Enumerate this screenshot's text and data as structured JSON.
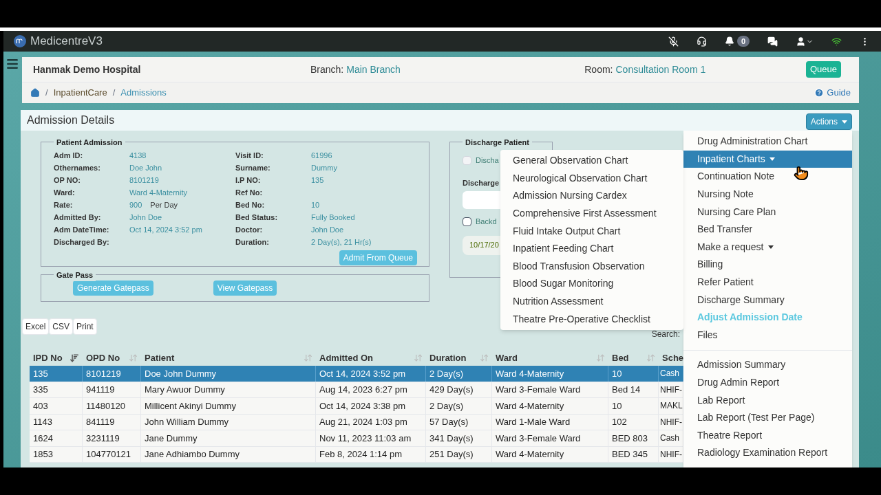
{
  "navbar": {
    "brand": "MedicentreV3",
    "notifications": "0"
  },
  "header": {
    "hospital": "Hanmak Demo Hospital",
    "branch_label": "Branch:",
    "branch": "Main Branch",
    "room_label": "Room:",
    "room": "Consultation Room 1",
    "queue_button": "Queue"
  },
  "breadcrumb": {
    "separator": "/",
    "items": [
      "InpatientCare",
      "Admissions"
    ],
    "guide": "Guide"
  },
  "card": {
    "title": "Admission Details",
    "actions_button": "Actions"
  },
  "patient_admission": {
    "legend": "Patient Admission",
    "left": [
      {
        "label": "Adm ID:",
        "value": "4138"
      },
      {
        "label": "Othernames:",
        "value": "Doe John"
      },
      {
        "label": "OP NO:",
        "value": "8101219"
      },
      {
        "label": "Ward:",
        "value": "Ward 4-Maternity"
      },
      {
        "label": "Rate:",
        "value": "900",
        "suffix": "Per Day"
      },
      {
        "label": "Admitted By:",
        "value": "John Doe"
      },
      {
        "label": "Adm DateTime:",
        "value": "Oct 14, 2024 3:52 pm"
      },
      {
        "label": "Discharged By:"
      }
    ],
    "right": [
      {
        "label": "Visit ID:",
        "value": "61996"
      },
      {
        "label": "Surname:",
        "value": "Dummy"
      },
      {
        "label": "I.P NO:",
        "value": "135"
      },
      {
        "label": "Ref No:"
      },
      {
        "label": "Bed No:",
        "value": "10"
      },
      {
        "label": "Bed Status:",
        "value": "Fully Booked"
      },
      {
        "label": "Doctor:",
        "value": "John Doe"
      },
      {
        "label": "Duration:",
        "value": "2 Day(s), 21 Hr(s)"
      }
    ],
    "button": "Admit From Queue"
  },
  "gate_pass": {
    "legend": "Gate Pass",
    "buttons": [
      "Generate Gatepass",
      "View Gatepass"
    ]
  },
  "discharge": {
    "legend": "Discharge Patient",
    "checkbox": {
      "label": "Discha",
      "checked": false,
      "disabled": true
    },
    "field_label": "Discharge",
    "backdate": {
      "label": "Backd",
      "checked": false,
      "disabled": false
    },
    "date": "10/17/20"
  },
  "export_buttons": [
    "Excel",
    "CSV",
    "Print"
  ],
  "search_label": "Search:",
  "table": {
    "columns": [
      {
        "label": "IPD No",
        "sorted": true
      },
      {
        "label": "OPD No",
        "sorted": false
      },
      {
        "label": "Patient",
        "sorted": false
      },
      {
        "label": "Admitted On",
        "sorted": false
      },
      {
        "label": "Duration",
        "sorted": false
      },
      {
        "label": "Ward",
        "sorted": false
      },
      {
        "label": "Bed",
        "sorted": false
      },
      {
        "label": "Sche"
      }
    ],
    "rows": [
      {
        "selected": true,
        "cells": [
          "135",
          "8101219",
          "Doe John Dummy",
          "Oct 14, 2024 3:52 pm",
          "2 Day(s)",
          "Ward 4-Maternity",
          "10",
          "Cash"
        ]
      },
      {
        "selected": false,
        "cells": [
          "335",
          "941119",
          "Mary Awuor Dummy",
          "Aug 14, 2023 6:27 pm",
          "429 Day(s)",
          "Ward 3-Female Ward",
          "Bed 14",
          "NHIF-"
        ]
      },
      {
        "selected": false,
        "cells": [
          "403",
          "11480120",
          "Millicent Akinyi Dummy",
          "Oct 14, 2024 3:38 pm",
          "2 Day(s)",
          "Ward 4-Maternity",
          "10",
          "MAKL"
        ]
      },
      {
        "selected": false,
        "cells": [
          "1143",
          "841119",
          "John William Dummy",
          "Aug 21, 2024 1:03 pm",
          "57 Day(s)",
          "Ward 1-Male Ward",
          "102",
          "NHIF-"
        ]
      },
      {
        "selected": false,
        "cells": [
          "1624",
          "3231119",
          "Jane Dummy",
          "Nov 11, 2023 11:03 am",
          "341 Day(s)",
          "Ward 3-Female Ward",
          "BED 803",
          "Cash"
        ]
      },
      {
        "selected": false,
        "cells": [
          "1853",
          "104770121",
          "Jane Adhiambo Dummy",
          "Feb 8, 2024 1:14 pm",
          "251 Day(s)",
          "Ward 4-Maternity",
          "BED 345",
          "NHIF-"
        ]
      }
    ]
  },
  "actions_menu": {
    "groups": [
      [
        {
          "label": "Drug Administration Chart",
          "kind": "item",
          "selected": false
        },
        {
          "label": "Inpatient Charts",
          "kind": "dropdown",
          "selected": true
        },
        {
          "label": "Continuation Note",
          "kind": "item",
          "selected": false
        },
        {
          "label": "Nursing Note",
          "kind": "item",
          "selected": false
        },
        {
          "label": "Nursing Care Plan",
          "kind": "item",
          "selected": false
        },
        {
          "label": "Bed Transfer",
          "kind": "item",
          "selected": false
        },
        {
          "label": "Make a request",
          "kind": "dropdown",
          "selected": false
        },
        {
          "label": "Billing",
          "kind": "item",
          "selected": false
        },
        {
          "label": "Refer Patient",
          "kind": "item",
          "selected": false
        },
        {
          "label": "Discharge Summary",
          "kind": "item",
          "selected": false
        },
        {
          "label": "Adjust Admission Date",
          "kind": "accent",
          "selected": false
        },
        {
          "label": "Files",
          "kind": "item",
          "selected": false
        }
      ],
      [
        {
          "label": "Admission Summary",
          "kind": "item",
          "selected": false
        },
        {
          "label": "Drug Admin Report",
          "kind": "item",
          "selected": false
        },
        {
          "label": "Lab Report",
          "kind": "item",
          "selected": false
        },
        {
          "label": "Lab Report (Test Per Page)",
          "kind": "item",
          "selected": false
        },
        {
          "label": "Theatre Report",
          "kind": "item",
          "selected": false
        },
        {
          "label": "Radiology Examination Report",
          "kind": "item",
          "selected": false
        }
      ]
    ]
  },
  "submenu": [
    "General Observation Chart",
    "Neurological Observation Chart",
    "Admission Nursing Cardex",
    "Comprehensive First Assessment",
    "Fluid Intake Output Chart",
    "Inpatient Feeding Chart",
    "Blood Transfusion Observation",
    "Blood Sugar Monitoring",
    "Nutrition Assessment",
    "Theatre Pre-Operative Checklist"
  ]
}
